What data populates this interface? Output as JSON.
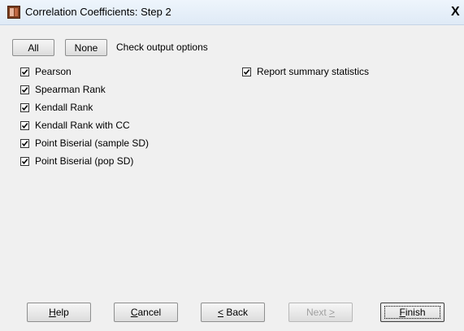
{
  "window": {
    "title": "Correlation Coefficients: Step 2",
    "close_glyph": "X"
  },
  "toolbar": {
    "all_label": "All",
    "none_label": "None",
    "check_output_label": "Check output options"
  },
  "options_left": [
    {
      "label": "Pearson",
      "checked": true
    },
    {
      "label": "Spearman Rank",
      "checked": true
    },
    {
      "label": "Kendall Rank",
      "checked": true
    },
    {
      "label": "Kendall Rank with CC",
      "checked": true
    },
    {
      "label": "Point Biserial (sample SD)",
      "checked": true
    },
    {
      "label": "Point Biserial (pop SD)",
      "checked": true
    }
  ],
  "options_right": [
    {
      "label": "Report summary statistics",
      "checked": true
    }
  ],
  "footer": {
    "help": {
      "pre": "",
      "mn": "H",
      "post": "elp"
    },
    "cancel": {
      "pre": "",
      "mn": "C",
      "post": "ancel"
    },
    "back": {
      "pre": "",
      "mn": "<",
      "post": " Back"
    },
    "next": {
      "pre": "Next ",
      "mn": ">",
      "post": ""
    },
    "finish": {
      "pre": "",
      "mn": "F",
      "post": "inish"
    }
  },
  "icons": {
    "app": "app-icon",
    "close": "close-icon",
    "check": "check-icon"
  }
}
